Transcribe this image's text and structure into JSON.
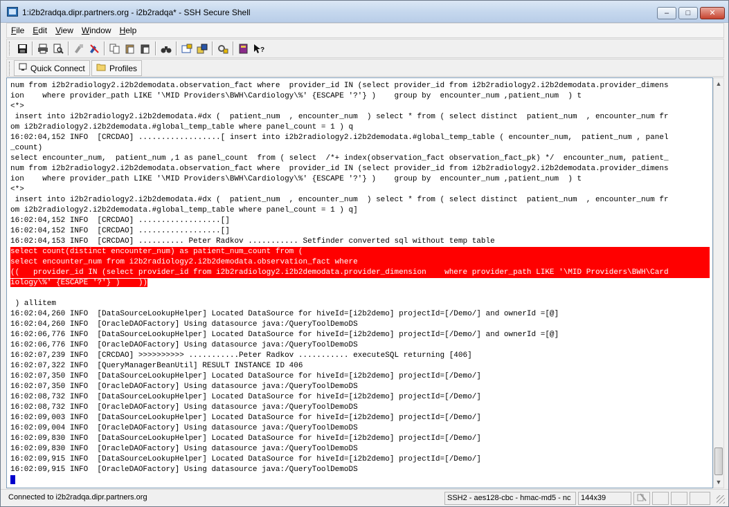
{
  "window": {
    "title": "1:i2b2radqa.dipr.partners.org - i2b2radqa* - SSH Secure Shell",
    "minimize_glyph": "–",
    "maximize_glyph": "□",
    "close_glyph": "✕"
  },
  "menu": [
    {
      "accel": "F",
      "rest": "ile"
    },
    {
      "accel": "E",
      "rest": "dit"
    },
    {
      "accel": "V",
      "rest": "iew"
    },
    {
      "accel": "W",
      "rest": "indow"
    },
    {
      "accel": "H",
      "rest": "elp"
    }
  ],
  "toolbar": {
    "icons": [
      "save-icon",
      "print-icon",
      "print-preview-icon",
      "disconnect-icon",
      "reconnect-icon",
      "copy-icon",
      "paste-icon",
      "paste-special-icon",
      "find-icon",
      "settings-icon",
      "file-transfer-icon",
      "profiles-settings-icon",
      "help-icon",
      "context-help-icon"
    ]
  },
  "quickbar": {
    "quick_connect_label": "Quick Connect",
    "profiles_label": "Profiles"
  },
  "terminal": {
    "lines": [
      {
        "text": "num from i2b2radiology2.i2b2demodata.observation_fact where  provider_id IN (select provider_id from i2b2radiology2.i2b2demodata.provider_dimens",
        "hl": false
      },
      {
        "text": "ion    where provider_path LIKE '\\MID Providers\\BWH\\Cardiology\\%' {ESCAPE '?'} )    group by  encounter_num ,patient_num  ) t",
        "hl": false
      },
      {
        "text": "<*>",
        "hl": false
      },
      {
        "text": " insert into i2b2radiology2.i2b2demodata.#dx (  patient_num  , encounter_num  ) select * from ( select distinct  patient_num  , encounter_num fr",
        "hl": false
      },
      {
        "text": "om i2b2radiology2.i2b2demodata.#global_temp_table where panel_count = 1 ) q",
        "hl": false
      },
      {
        "text": "16:02:04,152 INFO  [CRCDAO] ..................[ insert into i2b2radiology2.i2b2demodata.#global_temp_table ( encounter_num,  patient_num , panel",
        "hl": false
      },
      {
        "text": "_count)",
        "hl": false
      },
      {
        "text": "select encounter_num,  patient_num ,1 as panel_count  from ( select  /*+ index(observation_fact observation_fact_pk) */  encounter_num, patient_",
        "hl": false
      },
      {
        "text": "num from i2b2radiology2.i2b2demodata.observation_fact where  provider_id IN (select provider_id from i2b2radiology2.i2b2demodata.provider_dimens",
        "hl": false
      },
      {
        "text": "ion    where provider_path LIKE '\\MID Providers\\BWH\\Cardiology\\%' {ESCAPE '?'} )    group by  encounter_num ,patient_num  ) t",
        "hl": false
      },
      {
        "text": "<*>",
        "hl": false
      },
      {
        "text": " insert into i2b2radiology2.i2b2demodata.#dx (  patient_num  , encounter_num  ) select * from ( select distinct  patient_num  , encounter_num fr",
        "hl": false
      },
      {
        "text": "om i2b2radiology2.i2b2demodata.#global_temp_table where panel_count = 1 ) q]",
        "hl": false
      },
      {
        "text": "16:02:04,152 INFO  [CRCDAO] ..................[]",
        "hl": false
      },
      {
        "text": "16:02:04,152 INFO  [CRCDAO] ..................[]",
        "hl": false
      },
      {
        "text": "16:02:04,153 INFO  [CRCDAO] .......... Peter Radkov ........... Setfinder converted sql without temp table",
        "hl": false
      },
      {
        "text": "select count(distinct encounter_num) as patient_num_count from (",
        "hl": true
      },
      {
        "text": "select encounter_num from i2b2radiology2.i2b2demodata.observation_fact where",
        "hl": true
      },
      {
        "text": "((   provider_id IN (select provider_id from i2b2radiology2.i2b2demodata.provider_dimension    where provider_path LIKE '\\MID Providers\\BWH\\Card",
        "hl": true
      },
      {
        "text": "iology\\%' {ESCAPE '?'} )    ))",
        "hl": "partial"
      },
      {
        "text": "",
        "hl": false
      },
      {
        "text": " ) allitem",
        "hl": false
      },
      {
        "text": "16:02:04,260 INFO  [DataSourceLookupHelper] Located DataSource for hiveId=[i2b2demo] projectId=[/Demo/] and ownerId =[@]",
        "hl": false
      },
      {
        "text": "16:02:04,260 INFO  [OracleDAOFactory] Using datasource java:/QueryToolDemoDS",
        "hl": false
      },
      {
        "text": "16:02:06,776 INFO  [DataSourceLookupHelper] Located DataSource for hiveId=[i2b2demo] projectId=[/Demo/] and ownerId =[@]",
        "hl": false
      },
      {
        "text": "16:02:06,776 INFO  [OracleDAOFactory] Using datasource java:/QueryToolDemoDS",
        "hl": false
      },
      {
        "text": "16:02:07,239 INFO  [CRCDAO] >>>>>>>>>> ...........Peter Radkov ........... executeSQL returning [406]",
        "hl": false
      },
      {
        "text": "16:02:07,322 INFO  [QueryManagerBeanUtil] RESULT INSTANCE ID 406",
        "hl": false
      },
      {
        "text": "16:02:07,350 INFO  [DataSourceLookupHelper] Located DataSource for hiveId=[i2b2demo] projectId=[/Demo/]",
        "hl": false
      },
      {
        "text": "16:02:07,350 INFO  [OracleDAOFactory] Using datasource java:/QueryToolDemoDS",
        "hl": false
      },
      {
        "text": "16:02:08,732 INFO  [DataSourceLookupHelper] Located DataSource for hiveId=[i2b2demo] projectId=[/Demo/]",
        "hl": false
      },
      {
        "text": "16:02:08,732 INFO  [OracleDAOFactory] Using datasource java:/QueryToolDemoDS",
        "hl": false
      },
      {
        "text": "16:02:09,003 INFO  [DataSourceLookupHelper] Located DataSource for hiveId=[i2b2demo] projectId=[/Demo/]",
        "hl": false
      },
      {
        "text": "16:02:09,004 INFO  [OracleDAOFactory] Using datasource java:/QueryToolDemoDS",
        "hl": false
      },
      {
        "text": "16:02:09,830 INFO  [DataSourceLookupHelper] Located DataSource for hiveId=[i2b2demo] projectId=[/Demo/]",
        "hl": false
      },
      {
        "text": "16:02:09,830 INFO  [OracleDAOFactory] Using datasource java:/QueryToolDemoDS",
        "hl": false
      },
      {
        "text": "16:02:09,915 INFO  [DataSourceLookupHelper] Located DataSource for hiveId=[i2b2demo] projectId=[/Demo/]",
        "hl": false
      },
      {
        "text": "16:02:09,915 INFO  [OracleDAOFactory] Using datasource java:/QueryToolDemoDS",
        "hl": false
      }
    ],
    "highlight_color": "#ff0000",
    "cursor_color": "#0000cc"
  },
  "status": {
    "connection": "Connected to i2b2radqa.dipr.partners.org",
    "cipher": "SSH2 - aes128-cbc - hmac-md5 - nc",
    "terminal_size": "144x39"
  }
}
